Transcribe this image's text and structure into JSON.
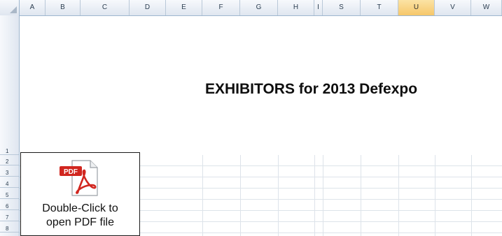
{
  "columns": [
    "A",
    "B",
    "C",
    "D",
    "E",
    "F",
    "G",
    "H",
    "I",
    "S",
    "T",
    "U",
    "V",
    "W"
  ],
  "selected_column": "U",
  "rows": [
    "1",
    "2",
    "3",
    "4",
    "5",
    "6",
    "7",
    "8"
  ],
  "title": "EXHIBITORS for 2013 Defexpo",
  "pdf_object": {
    "icon_badge": "PDF",
    "line1": "Double-Click to",
    "line2": "open PDF file"
  },
  "colors": {
    "header_bg": "#dfe6f0",
    "selected_header": "#f6c76a",
    "pdf_red": "#d1261f"
  }
}
